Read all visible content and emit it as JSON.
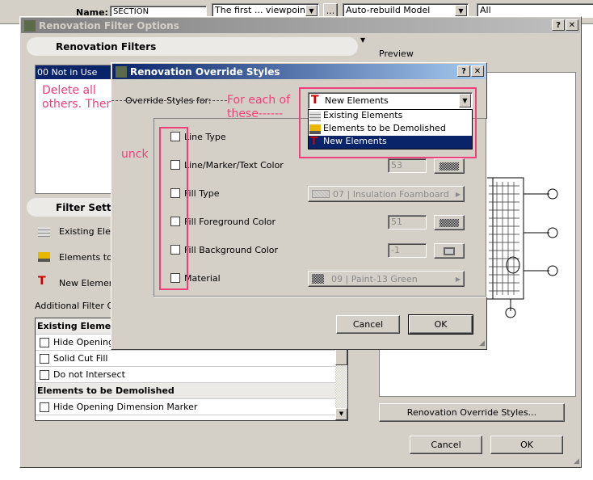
{
  "toolbar": {
    "name_label": "Name:",
    "name_value": "SECTION",
    "viewpoint": "The first ... viewpoint",
    "ellipsis": "...",
    "rebuild": "Auto-rebuild Model",
    "filter": "All"
  },
  "outer": {
    "title": "Renovation Filter Options",
    "filters_header": "Renovation Filters",
    "filters": [
      "00 Not in Use"
    ],
    "preview_label": "Preview",
    "filter_settings_header": "Filter Settin",
    "settings": [
      {
        "icon": "brick-wall-icon",
        "label": "Existing Eleme"
      },
      {
        "icon": "bulldozer-icon",
        "label": "Elements to b"
      },
      {
        "icon": "crane-icon",
        "label": "New Elements"
      }
    ],
    "additional_label": "Additional Filter Opt",
    "table": [
      {
        "type": "header",
        "label": "Existing Element"
      },
      {
        "type": "item",
        "label": "Hide Opening D",
        "checked": false
      },
      {
        "type": "item",
        "label": "Solid Cut Fill",
        "checked": false
      },
      {
        "type": "item",
        "label": "Do not Intersect",
        "checked": false
      },
      {
        "type": "header",
        "label": "Elements to be Demolished"
      },
      {
        "type": "item",
        "label": "Hide Opening Dimension Marker",
        "checked": false
      }
    ],
    "override_button": "Renovation Override Styles...",
    "cancel": "Cancel",
    "ok": "OK"
  },
  "inner": {
    "title": "Renovation Override Styles",
    "override_for_label": "Override Styles for:",
    "selected": "New Elements",
    "options": [
      "Existing Elements",
      "Elements to be Demolished",
      "New Elements"
    ],
    "rows": [
      {
        "label": "Line Type",
        "checked": false
      },
      {
        "label": "Line/Marker/Text Color",
        "checked": false,
        "value": "53"
      },
      {
        "label": "Fill Type",
        "checked": false,
        "value": "07 | Insulation Foamboard"
      },
      {
        "label": "Fill Foreground Color",
        "checked": false,
        "value": "51"
      },
      {
        "label": "Fill Background Color",
        "checked": false,
        "value": "-1"
      },
      {
        "label": "Material",
        "checked": false,
        "value": "09 | Paint-13 Green"
      }
    ],
    "cancel": "Cancel",
    "ok": "OK"
  },
  "annotations": {
    "note1": "Delete all others. Then",
    "note2": "For each of these------",
    "note3": "unck",
    "color": "#f0407a"
  }
}
